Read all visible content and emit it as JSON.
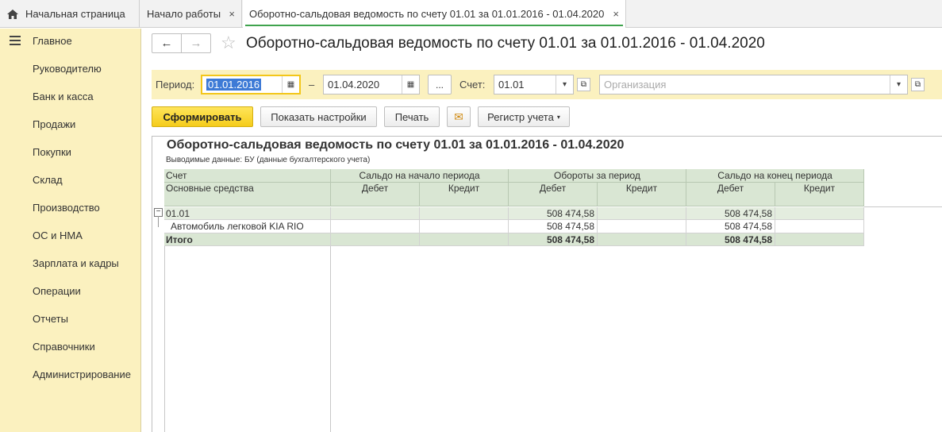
{
  "tabs": {
    "home": "Начальная страница",
    "start": "Начало работы",
    "active": "Оборотно-сальдовая ведомость по счету 01.01 за 01.01.2016 - 01.04.2020",
    "close": "×"
  },
  "sidebar": {
    "items": [
      "Главное",
      "Руководителю",
      "Банк и касса",
      "Продажи",
      "Покупки",
      "Склад",
      "Производство",
      "ОС и НМА",
      "Зарплата и кадры",
      "Операции",
      "Отчеты",
      "Справочники",
      "Администрирование"
    ]
  },
  "header": {
    "back": "←",
    "forward": "→",
    "star": "☆",
    "title": "Оборотно-сальдовая ведомость по счету 01.01 за 01.01.2016 - 01.04.2020"
  },
  "filters": {
    "period_label": "Период:",
    "date_from": "01.01.2016",
    "dash": "–",
    "date_to": "01.04.2020",
    "more": "...",
    "account_label": "Счет:",
    "account": "01.01",
    "org_placeholder": "Организация",
    "dropdown": "▾",
    "open": "⧉",
    "calendar": "▦"
  },
  "toolbar": {
    "generate": "Сформировать",
    "settings": "Показать настройки",
    "print": "Печать",
    "mail": "✉",
    "register": "Регистр учета"
  },
  "report": {
    "title": "Оборотно-сальдовая ведомость по счету 01.01 за 01.01.2016 - 01.04.2020",
    "subtitle": "Выводимые данные:  БУ (данные бухгалтерского учета)",
    "col_account": "Счет",
    "col_account2": "Основные средства",
    "groups": [
      "Сальдо на начало периода",
      "Обороты за период",
      "Сальдо на конец периода"
    ],
    "debit": "Дебет",
    "credit": "Кредит",
    "rows": [
      {
        "name": "01.01",
        "open_dt": "",
        "open_kt": "",
        "turn_dt": "508 474,58",
        "turn_kt": "",
        "close_dt": "508 474,58",
        "close_kt": ""
      },
      {
        "name": "Автомобиль легковой KIA RIO",
        "open_dt": "",
        "open_kt": "",
        "turn_dt": "508 474,58",
        "turn_kt": "",
        "close_dt": "508 474,58",
        "close_kt": ""
      },
      {
        "name": "Итого",
        "open_dt": "",
        "open_kt": "",
        "turn_dt": "508 474,58",
        "turn_kt": "",
        "close_dt": "508 474,58",
        "close_kt": ""
      }
    ],
    "collapse": "−"
  }
}
